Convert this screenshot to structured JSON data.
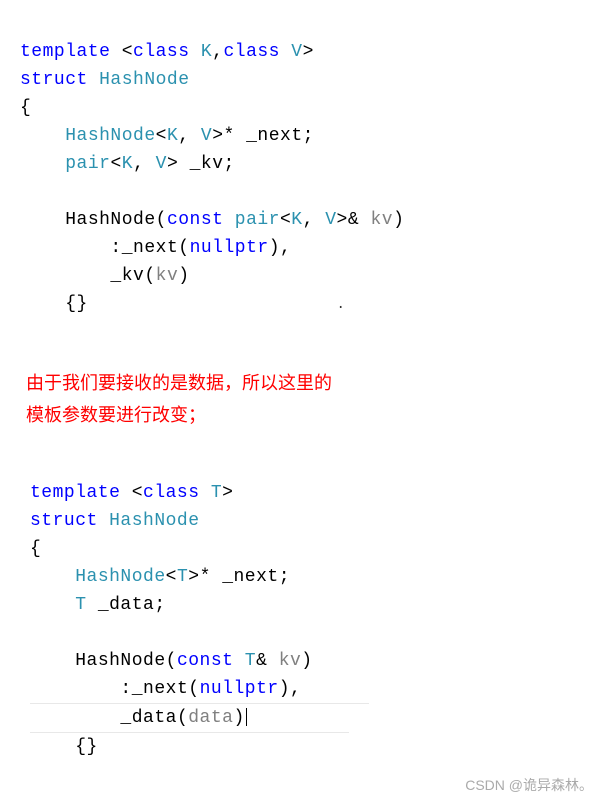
{
  "code1": {
    "l1": {
      "kw": "template ",
      "open": "<",
      "cls1": "class",
      "sp1": " K",
      "comma": ",",
      "cls2": "class",
      "sp2": " V",
      "close": ">"
    },
    "l2": {
      "kw": "struct ",
      "name": "HashNode"
    },
    "l3": "{",
    "l4": {
      "type": "HashNode",
      "open": "<",
      "k": "K",
      "c": ", ",
      "v": "V",
      "close": ">",
      "ptr": "* ",
      "field": "_next",
      ";": ";"
    },
    "l5": {
      "type": "pair",
      "open": "<",
      "k": "K",
      "c": ", ",
      "v": "V",
      "close": "> ",
      "field": "_kv",
      ";": ";"
    },
    "l6": "",
    "l7": {
      "ctor": "HashNode",
      "open": "(",
      "kw": "const ",
      "type": "pair",
      "t1": "<",
      "k": "K",
      "c": ", ",
      "v": "V",
      "t2": ">",
      "amp": "& ",
      "param": "kv",
      "close": ")"
    },
    "l8": {
      "colon": ":",
      "field": "_next",
      "open": "(",
      "kw": "nullptr",
      "close": "),"
    },
    "l9": {
      "field": "_kv",
      "open": "(",
      "param": "kv",
      "close": ")"
    },
    "l10": "{}",
    "dot": "."
  },
  "annotation": {
    "line1": "由于我们要接收的是数据，所以这里的",
    "line2": "模板参数要进行改变；"
  },
  "code2": {
    "l1": {
      "kw": "template ",
      "open": "<",
      "cls": "class",
      "sp": " T",
      "close": ">"
    },
    "l2": {
      "kw": "struct ",
      "name": "HashNode"
    },
    "l3": "{",
    "l4": {
      "type": "HashNode",
      "open": "<",
      "t": "T",
      "close": ">",
      "ptr": "* ",
      "field": "_next",
      ";": ";"
    },
    "l5": {
      "type": "T ",
      "field": "_data",
      ";": ";"
    },
    "l6": "",
    "l7": {
      "ctor": "HashNode",
      "open": "(",
      "kw": "const ",
      "type": "T",
      "amp": "& ",
      "param": "kv",
      "close": ")"
    },
    "l8": {
      "colon": ":",
      "field": "_next",
      "open": "(",
      "kw": "nullptr",
      "close": "),"
    },
    "l9": {
      "field": "_data",
      "open": "(",
      "param": "data",
      "close": ")"
    },
    "l10": "{}"
  },
  "watermark": "CSDN @诡异森林。"
}
